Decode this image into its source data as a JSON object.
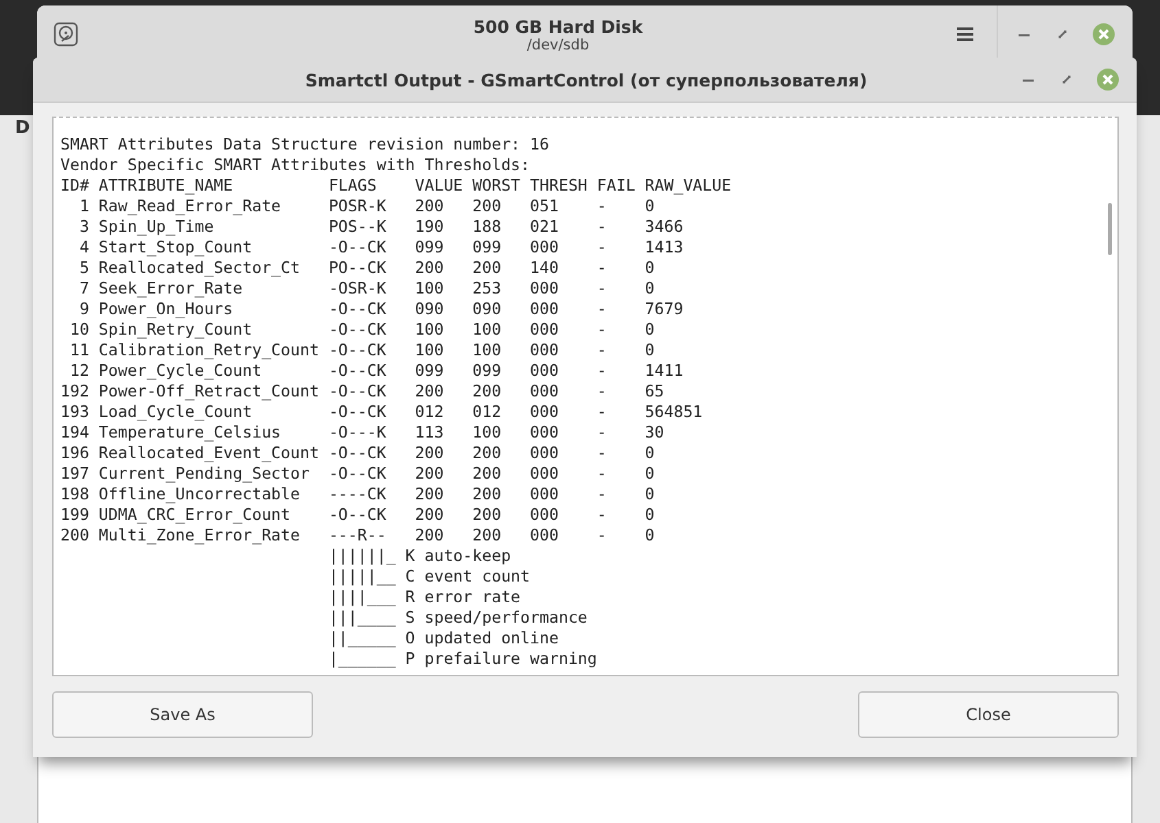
{
  "parent_window": {
    "title": "500 GB Hard Disk",
    "subtitle": "/dev/sdb",
    "content_label": "D"
  },
  "dialog": {
    "title": "Smartctl Output - GSmartControl (от суперпользователя)"
  },
  "output_lines": [
    "SMART Attributes Data Structure revision number: 16",
    "Vendor Specific SMART Attributes with Thresholds:",
    "ID# ATTRIBUTE_NAME          FLAGS    VALUE WORST THRESH FAIL RAW_VALUE",
    "  1 Raw_Read_Error_Rate     POSR-K   200   200   051    -    0",
    "  3 Spin_Up_Time            POS--K   190   188   021    -    3466",
    "  4 Start_Stop_Count        -O--CK   099   099   000    -    1413",
    "  5 Reallocated_Sector_Ct   PO--CK   200   200   140    -    0",
    "  7 Seek_Error_Rate         -OSR-K   100   253   000    -    0",
    "  9 Power_On_Hours          -O--CK   090   090   000    -    7679",
    " 10 Spin_Retry_Count        -O--CK   100   100   000    -    0",
    " 11 Calibration_Retry_Count -O--CK   100   100   000    -    0",
    " 12 Power_Cycle_Count       -O--CK   099   099   000    -    1411",
    "192 Power-Off_Retract_Count -O--CK   200   200   000    -    65",
    "193 Load_Cycle_Count        -O--CK   012   012   000    -    564851",
    "194 Temperature_Celsius     -O---K   113   100   000    -    30",
    "196 Reallocated_Event_Count -O--CK   200   200   000    -    0",
    "197 Current_Pending_Sector  -O--CK   200   200   000    -    0",
    "198 Offline_Uncorrectable   ----CK   200   200   000    -    0",
    "199 UDMA_CRC_Error_Count    -O--CK   200   200   000    -    0",
    "200 Multi_Zone_Error_Rate   ---R--   200   200   000    -    0",
    "                            ||||||_ K auto-keep",
    "                            |||||__ C event count",
    "                            ||||___ R error rate",
    "                            |||____ S speed/performance",
    "                            ||_____ O updated online",
    "                            |______ P prefailure warning"
  ],
  "buttons": [
    "Save As",
    "Close"
  ]
}
